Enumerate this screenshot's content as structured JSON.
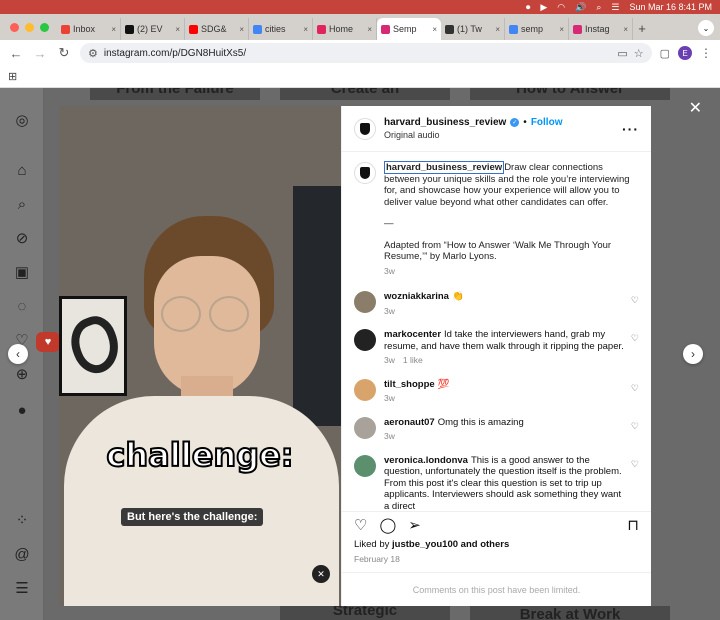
{
  "menubar": {
    "date_time": "Sun Mar 16  8:41 PM"
  },
  "browser": {
    "tabs": [
      {
        "label": "Inbox",
        "color": "#ea4335"
      },
      {
        "label": "(2) EV",
        "color": "#111111"
      },
      {
        "label": "SDG&",
        "color": "#ff0000"
      },
      {
        "label": "cities",
        "color": "#4285f4"
      },
      {
        "label": "Home",
        "color": "#e0245e"
      },
      {
        "label": "Semp",
        "color": "#d62976",
        "active": true
      },
      {
        "label": "(1) Tw",
        "color": "#333333"
      },
      {
        "label": "semp",
        "color": "#4285f4"
      },
      {
        "label": "Instag",
        "color": "#d62976"
      }
    ],
    "url": "instagram.com/p/DGN8HuitXs5/",
    "profile_initial": "E"
  },
  "video": {
    "caption_big": "challenge:",
    "caption_small": "But here's the challenge:"
  },
  "post": {
    "username": "harvard_business_review",
    "follow_label": "Follow",
    "audio": "Original audio",
    "caption_user": "harvard_business_review",
    "caption_text": "Draw clear connections between your unique skills and the role you’re interviewing for, and showcase how your experience will allow you to deliver value beyond what other candidates can offer.",
    "caption_dash": "—",
    "caption_source": "Adapted from “How to Answer ‘Walk Me Through Your Resume,’” by Marlo Lyons.",
    "caption_age": "3w",
    "comments": [
      {
        "user": "wozniakkarina",
        "text": "👏",
        "age": "3w",
        "likes": "",
        "avatar_color": "#8a7d6a"
      },
      {
        "user": "markocenter",
        "text": "Id take the interviewers hand, grab my resume, and have them walk through it ripping the paper.",
        "age": "3w",
        "likes": "1 like",
        "avatar_color": "#222222"
      },
      {
        "user": "tilt_shoppe",
        "text": "💯",
        "age": "3w",
        "likes": "",
        "avatar_color": "#d9a46c"
      },
      {
        "user": "aeronaut07",
        "text": "Omg this is amazing",
        "age": "3w",
        "likes": "",
        "avatar_color": "#a8a29a"
      },
      {
        "user": "veronica.londonva",
        "text": "This is a good answer to the question, unfortunately the question itself is the problem. From this post it's clear this question is set to trip up applicants. Interviewers should ask something they want a direct",
        "age": "",
        "likes": "",
        "avatar_color": "#5b8f6e"
      }
    ],
    "liked_by_prefix": "Liked by",
    "liked_by_user": "justbe_you100",
    "liked_by_suffix": "and others",
    "date": "February 18",
    "limited_notice": "Comments on this post have been limited."
  },
  "background_tiles": [
    {
      "text": "From the Failure"
    },
    {
      "text": "Create an"
    },
    {
      "text": "How to Answer"
    },
    {
      "text": "Strategic"
    },
    {
      "text": "Break at Work"
    }
  ]
}
